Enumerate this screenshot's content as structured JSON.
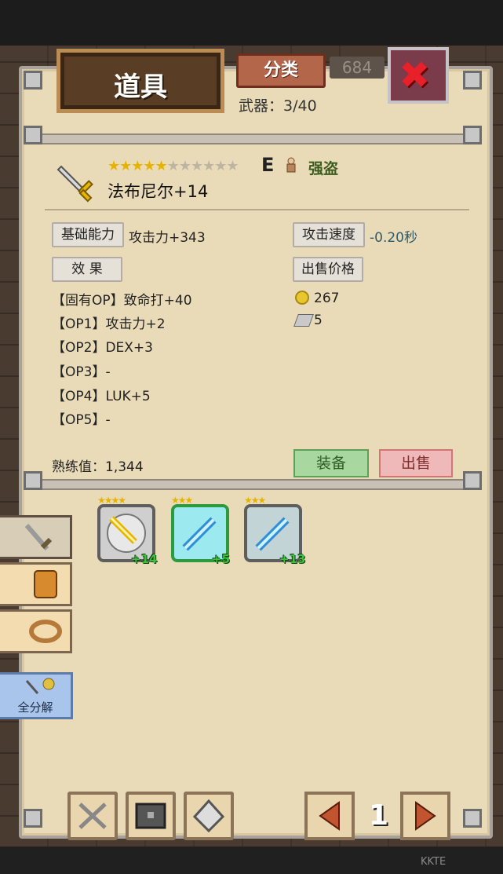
{
  "header": {
    "title": "道具",
    "category_button": "分类",
    "weapon_count": "武器：3/40",
    "background_count": "684",
    "close_label": "✖"
  },
  "item": {
    "name": "法布尼尔+14",
    "stars_filled": 5,
    "stars_total": 11,
    "grade": "E",
    "class": "强盗",
    "base_tag": "基础能力",
    "base_value": "攻击力+343",
    "speed_tag": "攻击速度",
    "speed_value": "-0.20秒",
    "effect_tag": "效 果",
    "price_tag": "出售价格",
    "options": [
      "【固有OP】致命打+40",
      "【OP1】攻击力+2",
      "【OP2】DEX+3",
      "【OP3】-",
      "【OP4】LUK+5",
      "【OP5】-"
    ],
    "price_gold": "267",
    "price_ore": "5",
    "proficiency": "熟练值：1,344",
    "equip_button": "装备",
    "sell_button": "出售"
  },
  "inventory": [
    {
      "stars": "★★★★",
      "plus": "+14",
      "type": "golden-sword",
      "equipped": false
    },
    {
      "stars": "★★★",
      "plus": "+5",
      "type": "ice-sword",
      "equipped": true
    },
    {
      "stars": "★★★",
      "plus": "+13",
      "type": "ice-sword",
      "equipped": false
    }
  ],
  "sidebar": {
    "tabs": [
      "sword-icon",
      "armor-icon",
      "ring-icon"
    ],
    "disassemble": "全分解"
  },
  "bottom": {
    "buttons": [
      "crossed-swords-icon",
      "chest-icon",
      "crystal-icon"
    ],
    "page": "1"
  },
  "watermark": "KKTE",
  "colors": {
    "equip": "#a8d8a0",
    "sell": "#f0b9b9",
    "close": "#e8202a"
  }
}
